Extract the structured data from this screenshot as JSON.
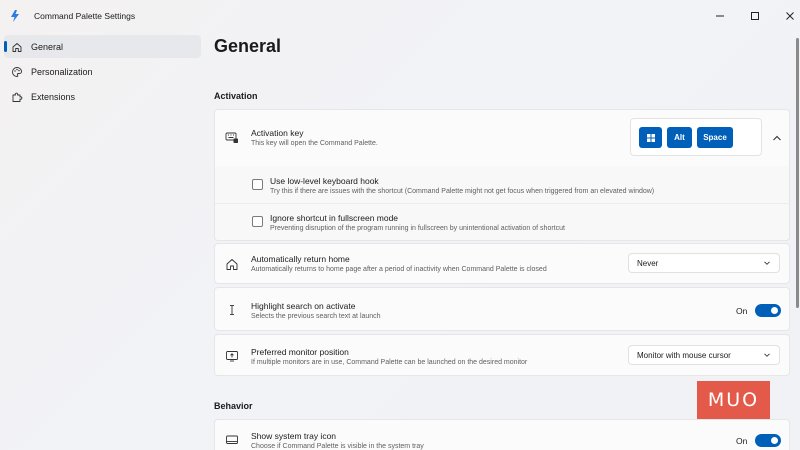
{
  "window": {
    "title": "Command Palette Settings",
    "controls": [
      "minimize",
      "maximize",
      "close"
    ]
  },
  "sidebar": {
    "items": [
      {
        "label": "General",
        "icon": "home-icon",
        "active": true
      },
      {
        "label": "Personalization",
        "icon": "palette-icon",
        "active": false
      },
      {
        "label": "Extensions",
        "icon": "puzzle-icon",
        "active": false
      }
    ]
  },
  "main": {
    "title": "General",
    "sections": {
      "activation": "Activation",
      "behavior": "Behavior"
    },
    "activation_key": {
      "title": "Activation key",
      "desc": "This key will open the Command Palette.",
      "keys": [
        "⊞",
        "Alt",
        "Space"
      ]
    },
    "low_level_hook": {
      "title": "Use low-level keyboard hook",
      "desc": "Try this if there are issues with the shortcut (Command Palette might not get focus when triggered from an elevated window)",
      "checked": false
    },
    "ignore_fullscreen": {
      "title": "Ignore shortcut in fullscreen mode",
      "desc": "Preventing disruption of the program running in fullscreen by unintentional activation of shortcut",
      "checked": false
    },
    "return_home": {
      "title": "Automatically return home",
      "desc": "Automatically returns to home page after a period of inactivity when Command Palette is closed",
      "value": "Never"
    },
    "highlight_search": {
      "title": "Highlight search on activate",
      "desc": "Selects the previous search text at launch",
      "state": "On"
    },
    "preferred_monitor": {
      "title": "Preferred monitor position",
      "desc": "If multiple monitors are in use, Command Palette can be launched on the desired monitor",
      "value": "Monitor with mouse cursor"
    },
    "system_tray": {
      "title": "Show system tray icon",
      "desc": "Choose if Command Palette is visible in the system tray",
      "state": "On"
    }
  },
  "watermark": "MUO",
  "colors": {
    "accent": "#005fb8",
    "watermark_bg": "#e35a4a"
  }
}
